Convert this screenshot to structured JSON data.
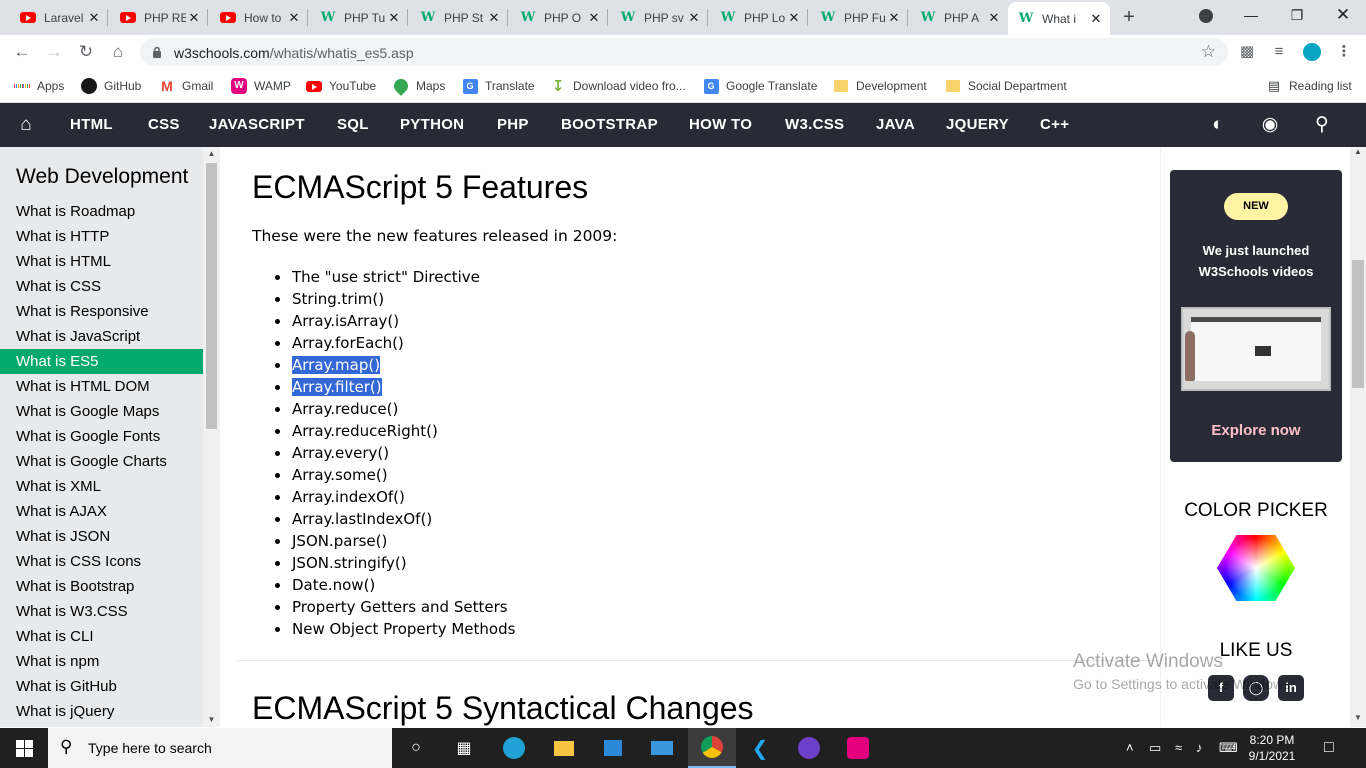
{
  "browser": {
    "tabs": [
      {
        "title": "Laravel",
        "icon": "youtube-icon"
      },
      {
        "title": "PHP RE",
        "icon": "youtube-icon"
      },
      {
        "title": "How to",
        "icon": "youtube-icon"
      },
      {
        "title": "PHP Tu",
        "icon": "w3schools-icon"
      },
      {
        "title": "PHP St",
        "icon": "w3schools-icon"
      },
      {
        "title": "PHP O",
        "icon": "w3schools-icon"
      },
      {
        "title": "PHP sv",
        "icon": "w3schools-icon"
      },
      {
        "title": "PHP Lo",
        "icon": "w3schools-icon"
      },
      {
        "title": "PHP Fu",
        "icon": "w3schools-icon"
      },
      {
        "title": "PHP A",
        "icon": "w3schools-icon"
      },
      {
        "title": "What i",
        "icon": "w3schools-icon",
        "active": true
      }
    ],
    "url_host": "w3schools.com",
    "url_path": "/whatis/whatis_es5.asp",
    "bookmarks": [
      {
        "label": "Apps",
        "icon": "apps-grid-icon"
      },
      {
        "label": "GitHub",
        "icon": "github-icon"
      },
      {
        "label": "Gmail",
        "icon": "gmail-icon"
      },
      {
        "label": "WAMP",
        "icon": "wamp-icon"
      },
      {
        "label": "YouTube",
        "icon": "youtube-icon"
      },
      {
        "label": "Maps",
        "icon": "maps-icon"
      },
      {
        "label": "Translate",
        "icon": "translate-icon"
      },
      {
        "label": "Download video fro...",
        "icon": "download-icon"
      },
      {
        "label": "Google Translate",
        "icon": "translate-icon"
      },
      {
        "label": "Development",
        "icon": "folder-icon"
      },
      {
        "label": "Social Department",
        "icon": "folder-icon"
      }
    ],
    "reading_list": "Reading list"
  },
  "nav": {
    "items": [
      "HTML",
      "CSS",
      "JAVASCRIPT",
      "SQL",
      "PYTHON",
      "PHP",
      "BOOTSTRAP",
      "HOW TO",
      "W3.CSS",
      "JAVA",
      "JQUERY",
      "C++"
    ]
  },
  "sidebar": {
    "title": "Web Development",
    "links": [
      "What is Roadmap",
      "What is HTTP",
      "What is HTML",
      "What is CSS",
      "What is Responsive",
      "What is JavaScript",
      "What is ES5",
      "What is HTML DOM",
      "What is Google Maps",
      "What is Google Fonts",
      "What is Google Charts",
      "What is XML",
      "What is AJAX",
      "What is JSON",
      "What is CSS Icons",
      "What is Bootstrap",
      "What is W3.CSS",
      "What is CLI",
      "What is npm",
      "What is GitHub",
      "What is jQuery"
    ],
    "active_link": "What is ES5"
  },
  "main": {
    "heading": "ECMAScript 5 Features",
    "intro": "These were the new features released in 2009:",
    "features": [
      "The \"use strict\" Directive",
      "String.trim()",
      "Array.isArray()",
      "Array.forEach()",
      "Array.map()",
      "Array.filter()",
      "Array.reduce()",
      "Array.reduceRight()",
      "Array.every()",
      "Array.some()",
      "Array.indexOf()",
      "Array.lastIndexOf()",
      "JSON.parse()",
      "JSON.stringify()",
      "Date.now()",
      "Property Getters and Setters",
      "New Object Property Methods"
    ],
    "selected_features": [
      "Array.map()",
      "Array.filter()"
    ],
    "heading2": "ECMAScript 5 Syntactical Changes"
  },
  "right": {
    "badge": "NEW",
    "promo_line1": "We just launched",
    "promo_line2": "W3Schools videos",
    "explore": "Explore now",
    "color_picker": "COLOR PICKER",
    "like_us": "LIKE US"
  },
  "watermark": {
    "line1": "Activate Windows",
    "line2": "Go to Settings to activate Windows."
  },
  "taskbar": {
    "search_placeholder": "Type here to search",
    "time": "8:20 PM",
    "date": "9/1/2021"
  },
  "colors": {
    "w3_green": "#04aa6d",
    "nav_bg": "#282a35",
    "selection": "#3367d6",
    "promo_badge": "#fff4a3",
    "explore_link": "#ffc0c7"
  }
}
